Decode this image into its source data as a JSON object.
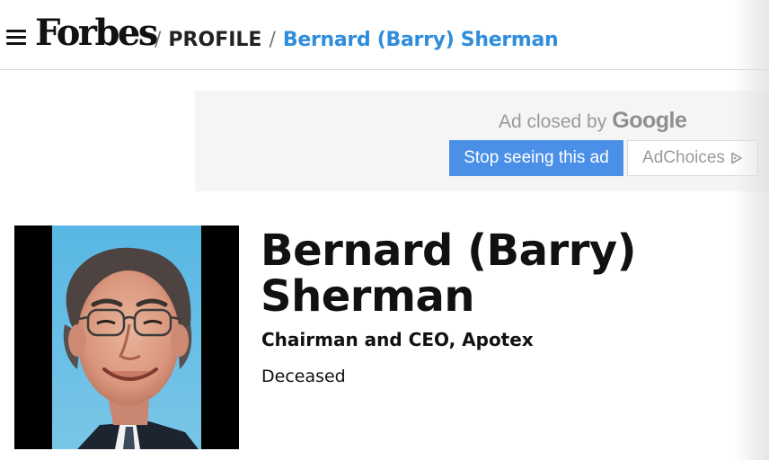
{
  "header": {
    "menu_icon": "hamburger-menu-icon",
    "logo": "Forbes",
    "separator": "/",
    "section": "PROFILE",
    "current": "Bernard (Barry) Sherman"
  },
  "ad": {
    "closed_text": "Ad closed by",
    "brand": "Google",
    "stop_button": "Stop seeing this ad",
    "adchoices_button": "AdChoices",
    "adchoices_icon": "adchoices-triangle-icon"
  },
  "profile": {
    "photo_alt": "Bernard (Barry) Sherman",
    "name": "Bernard (Barry) Sherman",
    "title": "Chairman and CEO, Apotex",
    "status": "Deceased"
  },
  "colors": {
    "link_blue": "#2f8ddc",
    "ad_button_blue": "#4a90e8",
    "ad_background": "#f5f5f5"
  }
}
